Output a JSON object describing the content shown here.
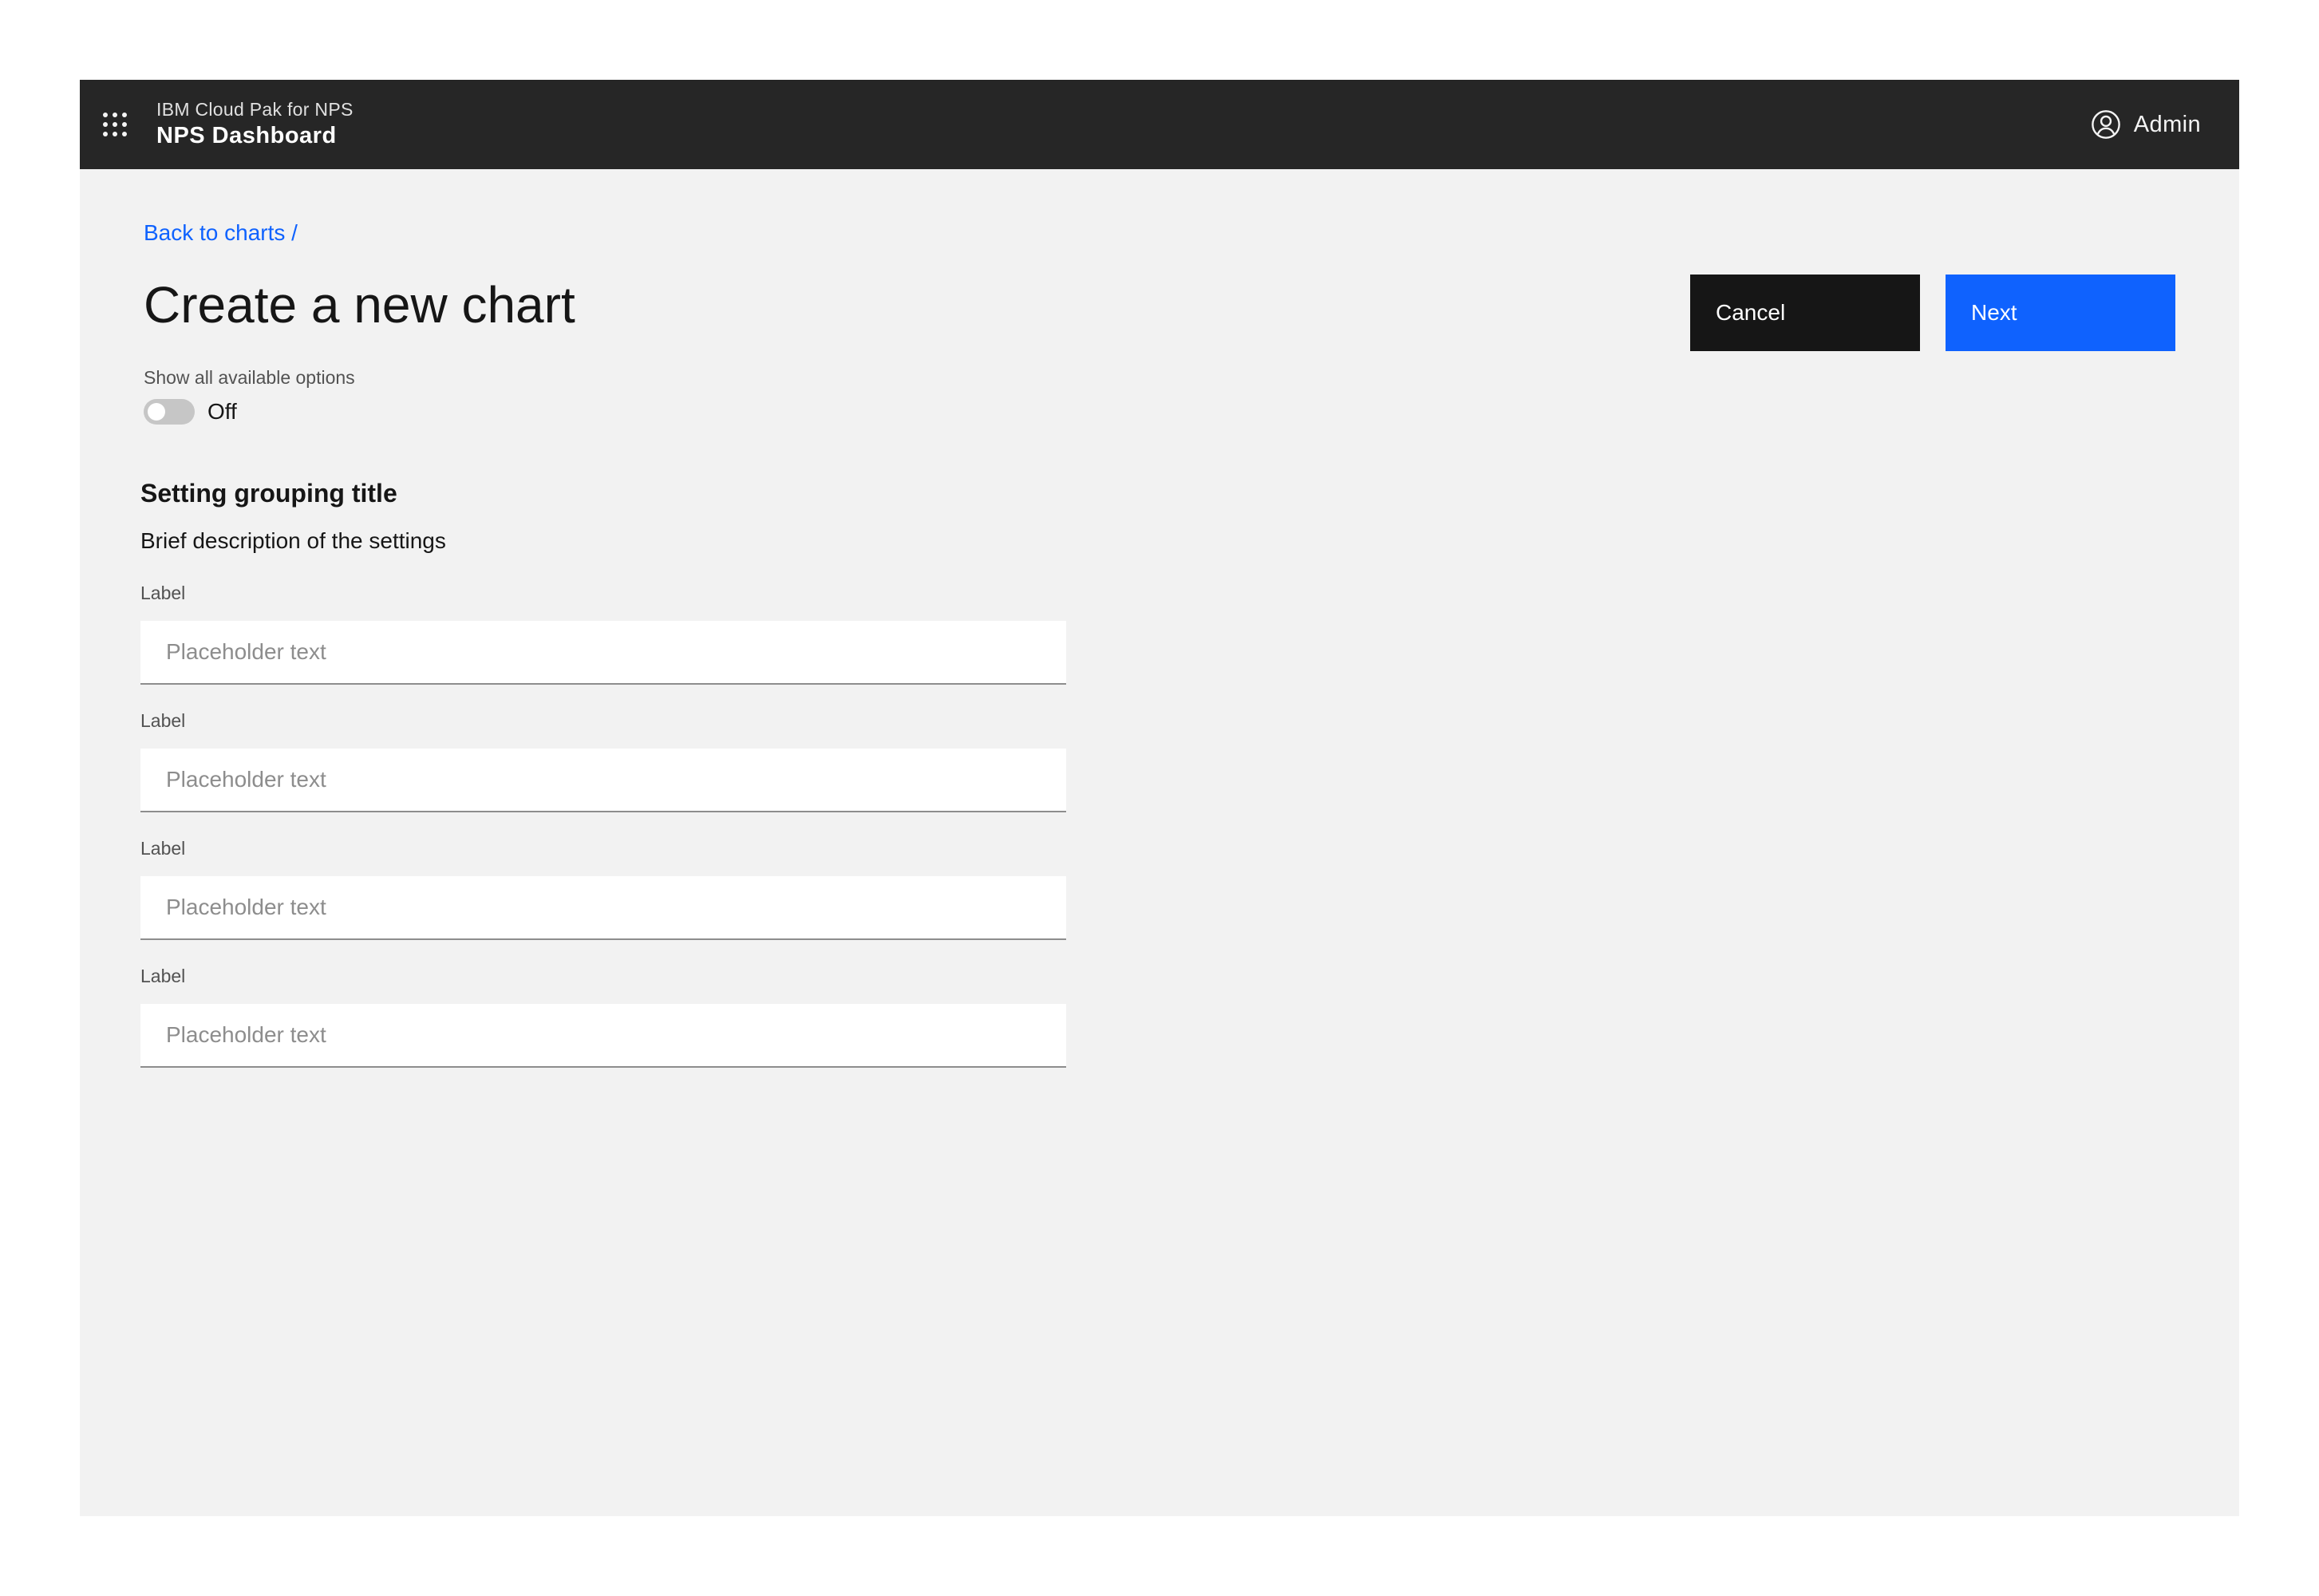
{
  "header": {
    "product_line": "IBM Cloud Pak for  NPS",
    "app_name": "NPS Dashboard",
    "user_label": "Admin"
  },
  "breadcrumb": {
    "label": "Back to charts /"
  },
  "page": {
    "title": "Create a new chart"
  },
  "actions": {
    "cancel_label": "Cancel",
    "next_label": "Next"
  },
  "toggle": {
    "label": "Show all available options",
    "state_text": "Off",
    "checked": false
  },
  "settings_group": {
    "title": "Setting grouping title",
    "description": "Brief description of the settings",
    "fields": [
      {
        "label": "Label",
        "placeholder": "Placeholder text",
        "value": ""
      },
      {
        "label": "Label",
        "placeholder": "Placeholder text",
        "value": ""
      },
      {
        "label": "Label",
        "placeholder": "Placeholder text",
        "value": ""
      },
      {
        "label": "Label",
        "placeholder": "Placeholder text",
        "value": ""
      }
    ]
  },
  "colors": {
    "header_bg": "#262626",
    "page_bg": "#f2f2f2",
    "primary": "#0f62fe",
    "secondary": "#161616",
    "toggle_off": "#c6c6c6"
  },
  "icons": {
    "app_switcher": "app-switcher-icon",
    "user": "user-avatar-icon"
  }
}
